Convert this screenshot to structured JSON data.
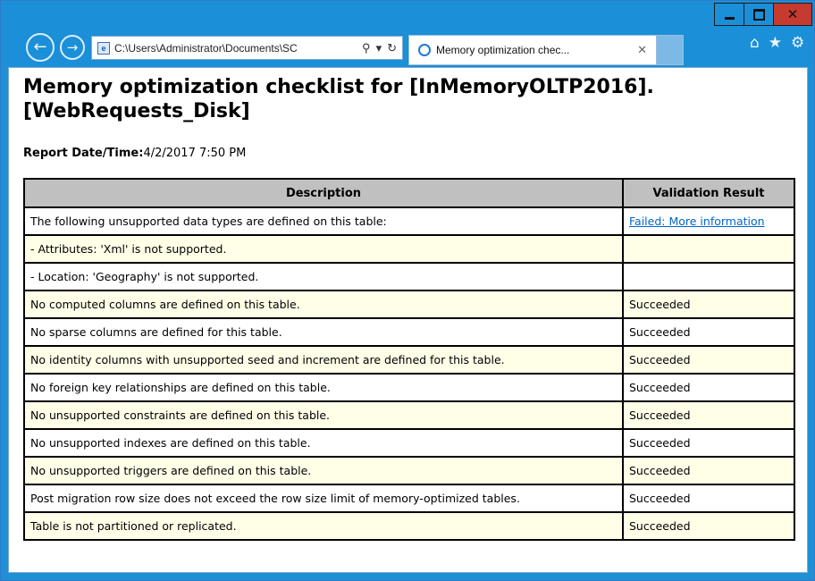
{
  "browser": {
    "address": "C:\\Users\\Administrator\\Documents\\SC",
    "tab_title": "Memory optimization chec...",
    "tab_close": "✕"
  },
  "page": {
    "title": "Memory optimization checklist for [InMemoryOLTP2016].[WebRequests_Disk]",
    "report_date_label": "Report Date/Time:",
    "report_date_value": "4/2/2017 7:50 PM"
  },
  "table": {
    "headers": [
      "Description",
      "Validation Result"
    ],
    "rows": [
      {
        "description": "The following unsupported data types are defined on this table:",
        "result": "Failed: More information",
        "is_link": true
      },
      {
        "description": "- Attributes: 'Xml' is not supported.",
        "result": ""
      },
      {
        "description": "- Location: 'Geography' is not supported.",
        "result": ""
      },
      {
        "description": "No computed columns are defined on this table.",
        "result": "Succeeded"
      },
      {
        "description": "No sparse columns are defined for this table.",
        "result": "Succeeded"
      },
      {
        "description": "No identity columns with unsupported seed and increment are defined for this table.",
        "result": "Succeeded"
      },
      {
        "description": "No foreign key relationships are defined on this table.",
        "result": "Succeeded"
      },
      {
        "description": "No unsupported constraints are defined on this table.",
        "result": "Succeeded"
      },
      {
        "description": "No unsupported indexes are defined on this table.",
        "result": "Succeeded"
      },
      {
        "description": "No unsupported triggers are defined on this table.",
        "result": "Succeeded"
      },
      {
        "description": "Post migration row size does not exceed the row size limit of memory-optimized tables.",
        "result": "Succeeded"
      },
      {
        "description": "Table is not partitioned or replicated.",
        "result": "Succeeded"
      }
    ]
  },
  "icons": {
    "back": "back-arrow-icon",
    "forward": "forward-arrow-icon",
    "home": "home-icon",
    "favorites": "star-icon",
    "settings": "gear-icon"
  },
  "colors": {
    "chrome": "#1b8fd8",
    "header_bg": "#c0c0c0",
    "odd_row": "#ffffe8",
    "link": "#0066cc",
    "close_button": "#c73a2f"
  }
}
